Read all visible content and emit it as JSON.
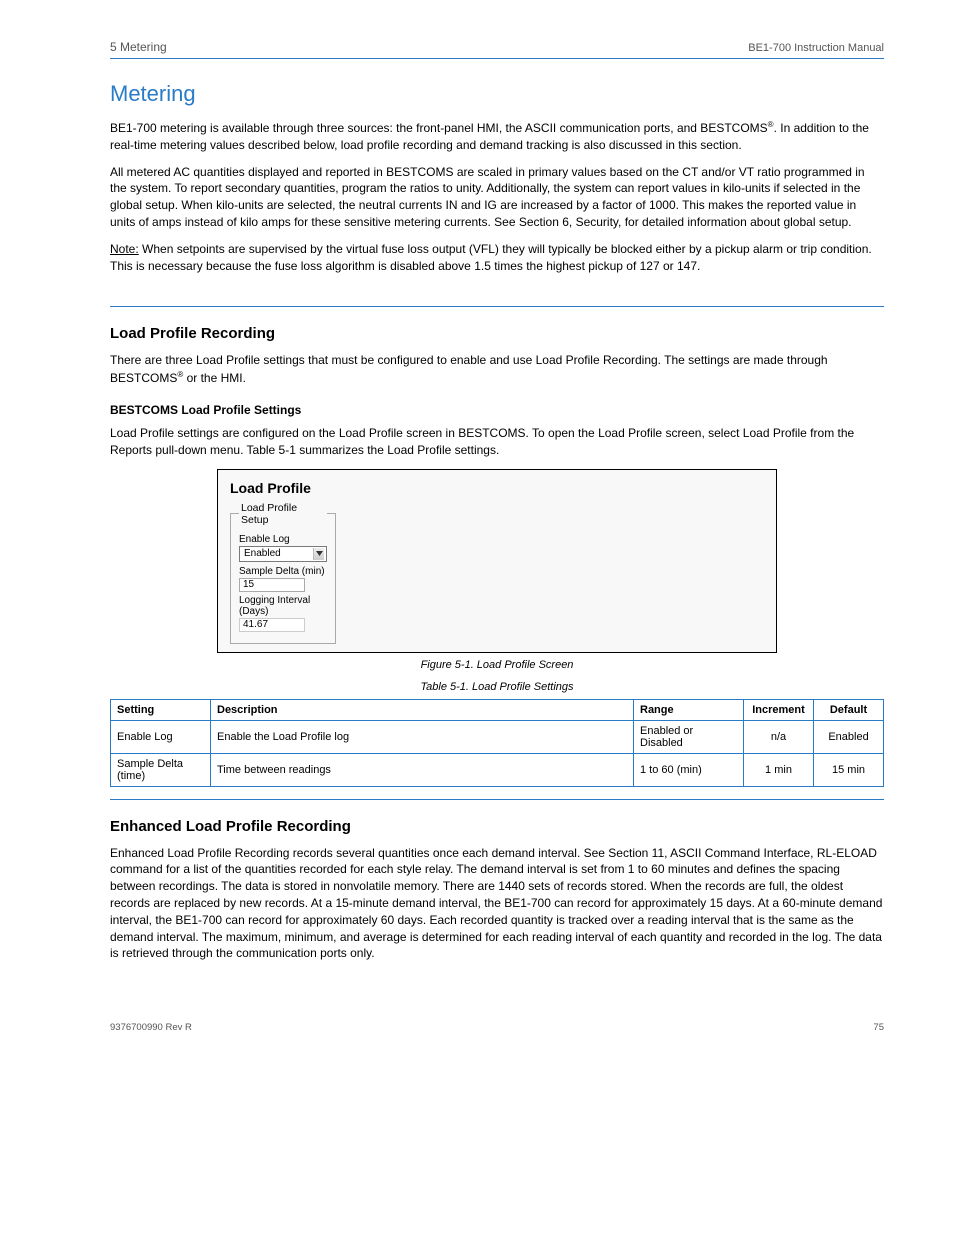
{
  "header": {
    "section": "5  Metering",
    "doc": "BE1-700 Instruction Manual"
  },
  "h1": "Metering",
  "intro": {
    "p1_prefix": "BE1-700 metering is available through three sources: the front-panel HMI, the ASCII communication ports, and BESTCOMS",
    "p1_suffix": ". In addition to the real-time metering values described below, load profile recording and demand tracking is also discussed in this section.",
    "p2": "All metered AC quantities displayed and reported in BESTCOMS are scaled in primary values based on the CT and/or VT ratio programmed in the system. To report secondary quantities, program the ratios to unity. Additionally, the system can report values in kilo-units if selected in the global setup. When kilo-units are selected, the neutral currents IN and IG are increased by a factor of 1000. This makes the reported value in units of amps instead of kilo amps for these sensitive metering currents. See Section 6, Security, for detailed information about global setup.",
    "note_label": "Note:",
    "note_text": "When setpoints are supervised by the virtual fuse loss output (VFL) they will typically be blocked either by a pickup alarm or trip condition. This is necessary because the fuse loss algorithm is disabled above 1.5 times the highest pickup of 127 or 147."
  },
  "section2": {
    "title": "Load Profile Recording",
    "p": "There are three Load Profile settings that must be configured to enable and use Load Profile Recording. The settings are made through BESTCOMS",
    "p_after": " or the HMI.",
    "sub1": "BESTCOMS Load Profile Settings",
    "sub1_p": "Load Profile settings are configured on the Load Profile screen in BESTCOMS. To open the Load Profile screen, select Load Profile from the Reports pull-down menu. Table 5-1 summarizes the Load Profile settings.",
    "figure": {
      "panel_title": "Load Profile",
      "legend": "Load Profile Setup",
      "enable_label": "Enable Log",
      "enable_value": "Enabled",
      "sample_label": "Sample Delta (min)",
      "sample_value": "15",
      "interval_label": "Logging Interval (Days)",
      "interval_value": "41.67"
    },
    "fig_caption": "Figure 5-1. Load Profile Screen",
    "table_title": "Table 5-1. Load Profile Settings",
    "table": {
      "headers": [
        "Setting",
        "Description",
        "Range",
        "Increment",
        "Default"
      ],
      "rows": [
        {
          "setting": "Enable Log",
          "desc": "Enable the Load Profile log",
          "range": "Enabled or Disabled",
          "inc": "n/a",
          "def": "Enabled"
        },
        {
          "setting": "Sample Delta (time)",
          "desc": "Time between readings",
          "range": "1 to 60 (min)",
          "inc": "1 min",
          "def": "15 min"
        }
      ]
    }
  },
  "section3": {
    "title": "Enhanced Load Profile Recording",
    "p": "Enhanced Load Profile Recording records several quantities once each demand interval. See Section 11, ASCII Command Interface, RL-ELOAD command for a list of the quantities recorded for each style relay. The demand interval is set from 1 to 60 minutes and defines the spacing between recordings. The data is stored in nonvolatile memory. There are 1440 sets of records stored. When the records are full, the oldest records are replaced by new records. At a 15-minute demand interval, the BE1-700 can record for approximately 15 days. At a 60-minute demand interval, the BE1-700 can record for approximately 60 days. Each recorded quantity is tracked over a reading interval that is the same as the demand interval. The maximum, minimum, and average is determined for each reading interval of each quantity and recorded in the log. The data is retrieved through the communication ports only."
  },
  "footer": {
    "left": "9376700990 Rev R",
    "right": "75"
  }
}
